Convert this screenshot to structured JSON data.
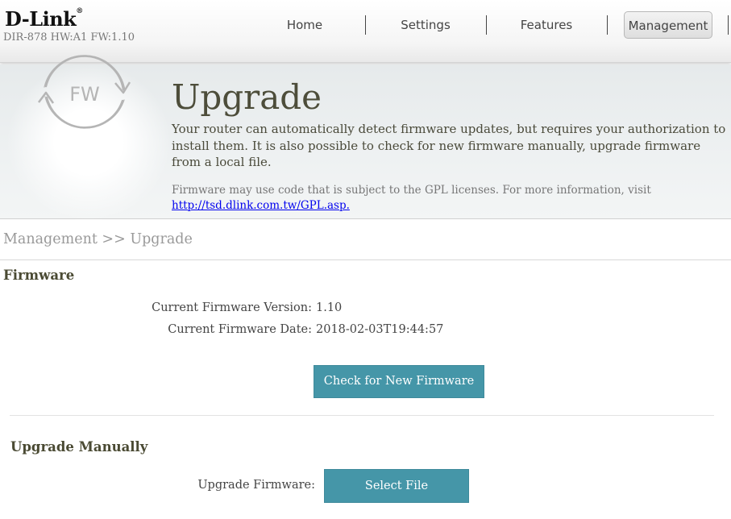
{
  "header": {
    "logo": "D-Link",
    "logo_mark": "®",
    "model_info": "DIR-878 HW:A1 FW:1.10",
    "nav": [
      {
        "label": "Home"
      },
      {
        "label": "Settings"
      },
      {
        "label": "Features"
      },
      {
        "label": "Management",
        "active": true
      }
    ]
  },
  "banner": {
    "icon_name": "firmware-refresh-icon",
    "icon_text": "FW",
    "title": "Upgrade",
    "description": "Your router can automatically detect firmware updates, but requires your authorization to install them. It is also possible to check for new firmware manually, upgrade firmware from a local file.",
    "gpl_text": "Firmware may use code that is subject to the GPL licenses. For more information, visit",
    "gpl_link": "http://tsd.dlink.com.tw/GPL.asp."
  },
  "breadcrumb": "Management >> Upgrade",
  "firmware": {
    "section_title": "Firmware",
    "version_label": "Current Firmware Version:",
    "version_value": "1.10",
    "date_label": "Current Firmware Date:",
    "date_value": "2018-02-03T19:44:57",
    "check_button": "Check for New Firmware"
  },
  "upgrade_manually": {
    "section_title": "Upgrade Manually",
    "upgrade_label": "Upgrade Firmware:",
    "select_button": "Select File"
  },
  "colors": {
    "button_bg": "#4596a8",
    "title_text": "#4d4d3a",
    "link": "#0000ee"
  }
}
